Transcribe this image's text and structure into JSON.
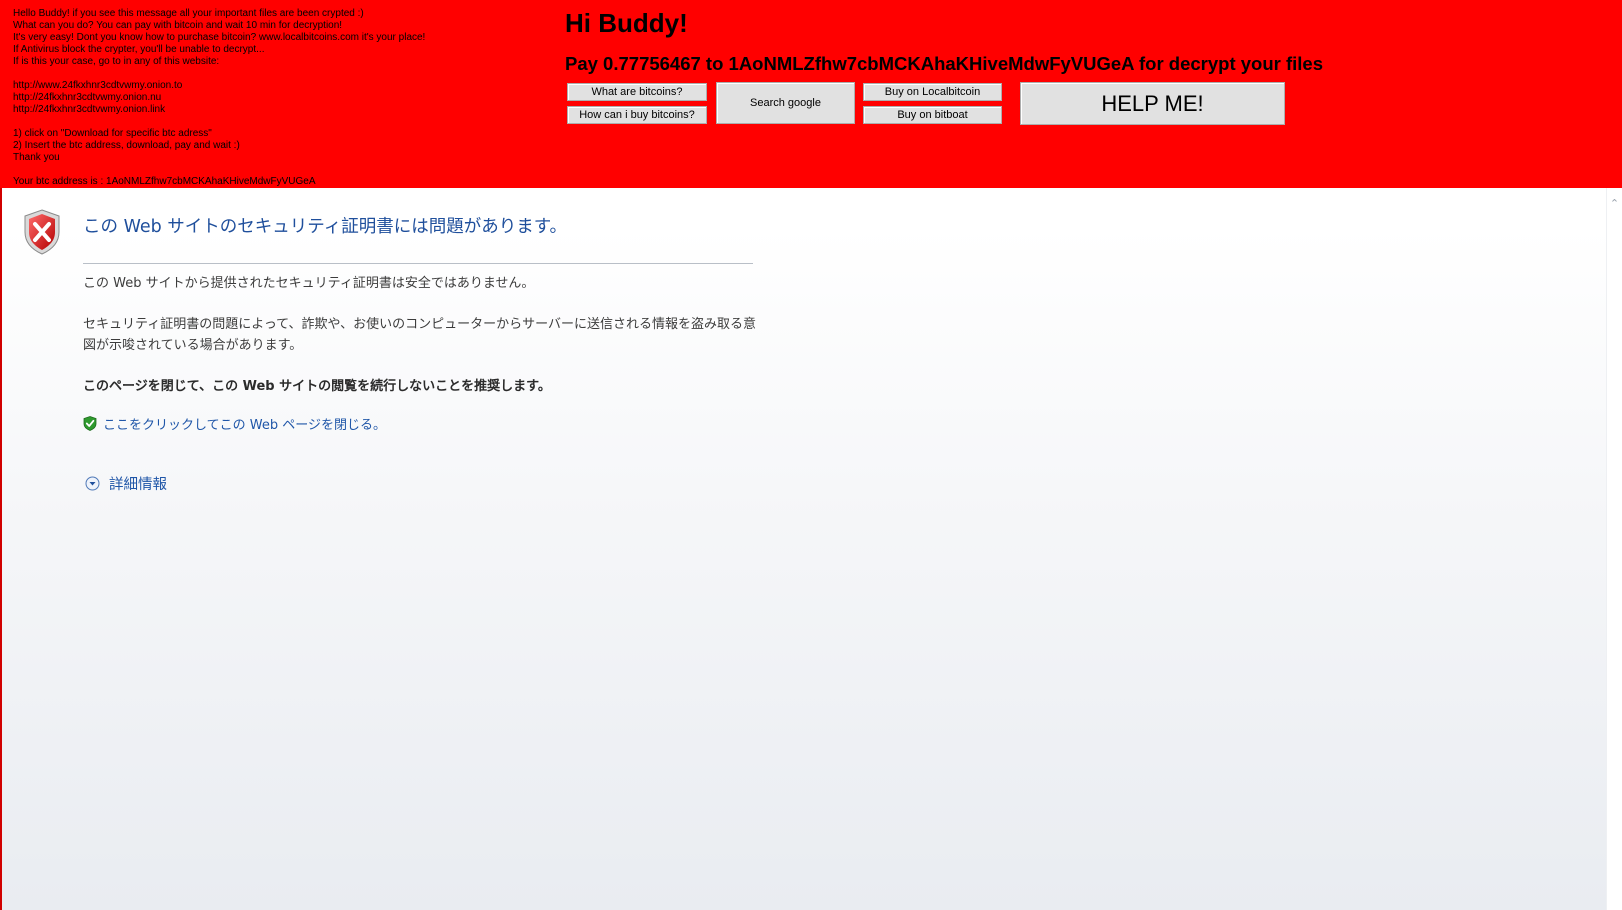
{
  "ransom": {
    "message_lines": [
      "Hello Buddy! if you see this message all your important files are been crypted :)",
      "What can you do? You can pay with bitcoin and wait 10 min for decryption!",
      "It's very easy! Dont you know how to purchase bitcoin? www.localbitcoins.com it's your place!",
      "If Antivirus block the crypter, you'll be unable to decrypt...",
      "If is this your case, go to in any of this website:",
      "",
      "http://www.24fkxhnr3cdtvwmy.onion.to",
      "http://24fkxhnr3cdtvwmy.onion.nu",
      "http://24fkxhnr3cdtvwmy.onion.link",
      "",
      "1) click on \"Download for specific btc adress\"",
      "2) Insert the btc address, download, pay and wait :)",
      "Thank you",
      "",
      "Your btc address is :  1AoNMLZfhw7cbMCKAhaKHiveMdwFyVUGeA"
    ],
    "headline": "Hi Buddy!",
    "pay_line": "Pay 0.77756467 to 1AoNMLZfhw7cbMCKAhaKHiveMdwFyVUGeA for decrypt your files",
    "buttons": {
      "what_are_bitcoins": "What are bitcoins?",
      "how_buy_bitcoins": "How can i buy bitcoins?",
      "search_google": "Search google",
      "buy_localbitcoin": "Buy on Localbitcoin",
      "buy_bitboat": "Buy on bitboat",
      "help_me": "HELP ME!"
    },
    "colors": {
      "banner_bg": "#ff0000",
      "button_bg": "#e1e1e1"
    }
  },
  "cert_error": {
    "title": "この Web サイトのセキュリティ証明書には問題があります。",
    "p1": "この Web サイトから提供されたセキュリティ証明書は安全ではありません。",
    "p2": "セキュリティ証明書の問題によって、詐欺や、お使いのコンピューターからサーバーに送信される情報を盗み取る意図が示唆されている場合があります。",
    "p3": "このページを閉じて、この Web サイトの閲覧を続行しないことを推奨します。",
    "close_link": "ここをクリックしてこの Web ページを閉じる。",
    "more_info": "詳細情報",
    "icons": {
      "error": "shield-x-icon",
      "close": "green-shield-check-icon",
      "expand": "chevron-down-circle-icon"
    },
    "colors": {
      "title": "#1f4f9c",
      "link": "#1f56a8",
      "body_text": "#3c3c3c"
    }
  }
}
